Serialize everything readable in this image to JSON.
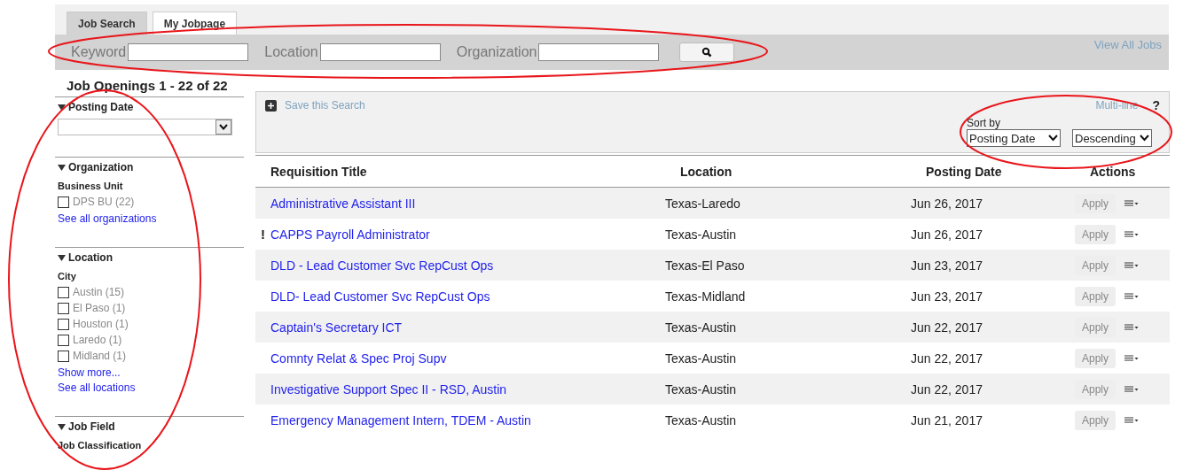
{
  "tabs": [
    {
      "label": "Job Search",
      "selected": true
    },
    {
      "label": "My Jobpage",
      "selected": false
    }
  ],
  "search": {
    "fields": [
      {
        "label": "Keyword"
      },
      {
        "label": "Location"
      },
      {
        "label": "Organization"
      }
    ],
    "view_all": "View All Jobs"
  },
  "heading": "Job Openings 1 - 22 of 22",
  "filters": [
    {
      "title": "Posting Date",
      "expanded": true,
      "kind": "select"
    },
    {
      "title": "Organization",
      "expanded": true,
      "kind": "checklist",
      "subtitle": "Business Unit",
      "options": [
        {
          "label": "DPS BU",
          "count": "(22)",
          "checked": false
        }
      ],
      "links": [
        "See all organizations"
      ]
    },
    {
      "title": "Location",
      "expanded": true,
      "kind": "checklist",
      "subtitle": "City",
      "options": [
        {
          "label": "Austin",
          "count": "(15)",
          "checked": false
        },
        {
          "label": "El Paso",
          "count": "(1)",
          "checked": false
        },
        {
          "label": "Houston",
          "count": "(1)",
          "checked": false
        },
        {
          "label": "Laredo",
          "count": "(1)",
          "checked": false
        },
        {
          "label": "Midland",
          "count": "(1)",
          "checked": false
        }
      ],
      "links": [
        "Show more...",
        "See all locations"
      ]
    },
    {
      "title": "Job Field",
      "expanded": true,
      "kind": "checklist",
      "subtitle": "Job Classification"
    }
  ],
  "toolbar": {
    "save": "Save this Search",
    "view_mode": "Multi-line",
    "help": "?",
    "sort_label": "Sort by",
    "sort_field": "Posting Date",
    "sort_order": "Descending"
  },
  "table": {
    "columns": [
      "Requisition Title",
      "Location",
      "Posting Date",
      "Actions"
    ],
    "rows": [
      {
        "title": "Administrative Assistant III",
        "location": "Texas-Laredo",
        "date": "Jun 26, 2017",
        "action": "Apply"
      },
      {
        "marker": "!",
        "title": "CAPPS Payroll Administrator",
        "location": "Texas-Austin",
        "date": "Jun 26, 2017",
        "action": "Apply"
      },
      {
        "title": "DLD - Lead Customer Svc RepCust Ops",
        "location": "Texas-El Paso",
        "date": "Jun 23, 2017",
        "action": "Apply"
      },
      {
        "title": "DLD- Lead Customer Svc RepCust Ops",
        "location": "Texas-Midland",
        "date": "Jun 23, 2017",
        "action": "Apply"
      },
      {
        "title": "Captain's Secretary ICT",
        "location": "Texas-Austin",
        "date": "Jun 22, 2017",
        "action": "Apply"
      },
      {
        "title": "Comnty Relat & Spec Proj Supv",
        "location": "Texas-Austin",
        "date": "Jun 22, 2017",
        "action": "Apply"
      },
      {
        "title": "Investigative Support Spec II - RSD, Austin",
        "location": "Texas-Austin",
        "date": "Jun 22, 2017",
        "action": "Apply"
      },
      {
        "title": "Emergency Management Intern, TDEM - Austin",
        "location": "Texas-Austin",
        "date": "Jun 21, 2017",
        "action": "Apply"
      }
    ]
  },
  "annotations": [
    {
      "kind": "ellipse"
    },
    {
      "kind": "ellipse"
    },
    {
      "kind": "ellipse"
    }
  ]
}
